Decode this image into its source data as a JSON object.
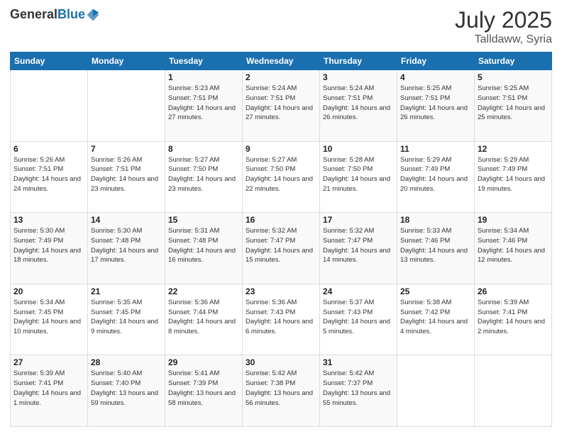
{
  "logo": {
    "general": "General",
    "blue": "Blue"
  },
  "header": {
    "month": "July 2025",
    "location": "Talldaww, Syria"
  },
  "weekdays": [
    "Sunday",
    "Monday",
    "Tuesday",
    "Wednesday",
    "Thursday",
    "Friday",
    "Saturday"
  ],
  "weeks": [
    [
      {
        "day": "",
        "info": ""
      },
      {
        "day": "",
        "info": ""
      },
      {
        "day": "1",
        "info": "Sunrise: 5:23 AM\nSunset: 7:51 PM\nDaylight: 14 hours and 27 minutes."
      },
      {
        "day": "2",
        "info": "Sunrise: 5:24 AM\nSunset: 7:51 PM\nDaylight: 14 hours and 27 minutes."
      },
      {
        "day": "3",
        "info": "Sunrise: 5:24 AM\nSunset: 7:51 PM\nDaylight: 14 hours and 26 minutes."
      },
      {
        "day": "4",
        "info": "Sunrise: 5:25 AM\nSunset: 7:51 PM\nDaylight: 14 hours and 26 minutes."
      },
      {
        "day": "5",
        "info": "Sunrise: 5:25 AM\nSunset: 7:51 PM\nDaylight: 14 hours and 25 minutes."
      }
    ],
    [
      {
        "day": "6",
        "info": "Sunrise: 5:26 AM\nSunset: 7:51 PM\nDaylight: 14 hours and 24 minutes."
      },
      {
        "day": "7",
        "info": "Sunrise: 5:26 AM\nSunset: 7:51 PM\nDaylight: 14 hours and 23 minutes."
      },
      {
        "day": "8",
        "info": "Sunrise: 5:27 AM\nSunset: 7:50 PM\nDaylight: 14 hours and 23 minutes."
      },
      {
        "day": "9",
        "info": "Sunrise: 5:27 AM\nSunset: 7:50 PM\nDaylight: 14 hours and 22 minutes."
      },
      {
        "day": "10",
        "info": "Sunrise: 5:28 AM\nSunset: 7:50 PM\nDaylight: 14 hours and 21 minutes."
      },
      {
        "day": "11",
        "info": "Sunrise: 5:29 AM\nSunset: 7:49 PM\nDaylight: 14 hours and 20 minutes."
      },
      {
        "day": "12",
        "info": "Sunrise: 5:29 AM\nSunset: 7:49 PM\nDaylight: 14 hours and 19 minutes."
      }
    ],
    [
      {
        "day": "13",
        "info": "Sunrise: 5:30 AM\nSunset: 7:49 PM\nDaylight: 14 hours and 18 minutes."
      },
      {
        "day": "14",
        "info": "Sunrise: 5:30 AM\nSunset: 7:48 PM\nDaylight: 14 hours and 17 minutes."
      },
      {
        "day": "15",
        "info": "Sunrise: 5:31 AM\nSunset: 7:48 PM\nDaylight: 14 hours and 16 minutes."
      },
      {
        "day": "16",
        "info": "Sunrise: 5:32 AM\nSunset: 7:47 PM\nDaylight: 14 hours and 15 minutes."
      },
      {
        "day": "17",
        "info": "Sunrise: 5:32 AM\nSunset: 7:47 PM\nDaylight: 14 hours and 14 minutes."
      },
      {
        "day": "18",
        "info": "Sunrise: 5:33 AM\nSunset: 7:46 PM\nDaylight: 14 hours and 13 minutes."
      },
      {
        "day": "19",
        "info": "Sunrise: 5:34 AM\nSunset: 7:46 PM\nDaylight: 14 hours and 12 minutes."
      }
    ],
    [
      {
        "day": "20",
        "info": "Sunrise: 5:34 AM\nSunset: 7:45 PM\nDaylight: 14 hours and 10 minutes."
      },
      {
        "day": "21",
        "info": "Sunrise: 5:35 AM\nSunset: 7:45 PM\nDaylight: 14 hours and 9 minutes."
      },
      {
        "day": "22",
        "info": "Sunrise: 5:36 AM\nSunset: 7:44 PM\nDaylight: 14 hours and 8 minutes."
      },
      {
        "day": "23",
        "info": "Sunrise: 5:36 AM\nSunset: 7:43 PM\nDaylight: 14 hours and 6 minutes."
      },
      {
        "day": "24",
        "info": "Sunrise: 5:37 AM\nSunset: 7:43 PM\nDaylight: 14 hours and 5 minutes."
      },
      {
        "day": "25",
        "info": "Sunrise: 5:38 AM\nSunset: 7:42 PM\nDaylight: 14 hours and 4 minutes."
      },
      {
        "day": "26",
        "info": "Sunrise: 5:39 AM\nSunset: 7:41 PM\nDaylight: 14 hours and 2 minutes."
      }
    ],
    [
      {
        "day": "27",
        "info": "Sunrise: 5:39 AM\nSunset: 7:41 PM\nDaylight: 14 hours and 1 minute."
      },
      {
        "day": "28",
        "info": "Sunrise: 5:40 AM\nSunset: 7:40 PM\nDaylight: 13 hours and 59 minutes."
      },
      {
        "day": "29",
        "info": "Sunrise: 5:41 AM\nSunset: 7:39 PM\nDaylight: 13 hours and 58 minutes."
      },
      {
        "day": "30",
        "info": "Sunrise: 5:42 AM\nSunset: 7:38 PM\nDaylight: 13 hours and 56 minutes."
      },
      {
        "day": "31",
        "info": "Sunrise: 5:42 AM\nSunset: 7:37 PM\nDaylight: 13 hours and 55 minutes."
      },
      {
        "day": "",
        "info": ""
      },
      {
        "day": "",
        "info": ""
      }
    ]
  ]
}
